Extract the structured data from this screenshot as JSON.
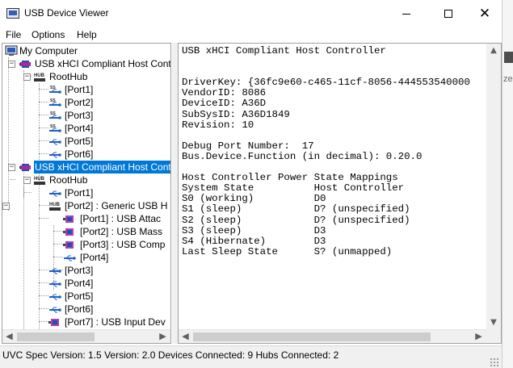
{
  "window": {
    "title": "USB Device Viewer",
    "controls": {
      "minimize": "minimize-icon",
      "maximize": "maximize-icon",
      "close": "close-icon"
    }
  },
  "menu": {
    "items": [
      "File",
      "Options",
      "Help"
    ]
  },
  "tree": {
    "nodes": [
      {
        "label": "My Computer",
        "icon": "computer-icon",
        "expander": ""
      },
      {
        "label": "USB xHCI Compliant Host Contr",
        "icon": "usb-controller-icon",
        "expander": "−"
      },
      {
        "label": "RootHub",
        "icon": "hub-icon",
        "expander": "−"
      },
      {
        "label": "[Port1]",
        "icon": "usb-port-ss-icon"
      },
      {
        "label": "[Port2]",
        "icon": "usb-port-ss-icon"
      },
      {
        "label": "[Port3]",
        "icon": "usb-port-ss-icon"
      },
      {
        "label": "[Port4]",
        "icon": "usb-port-ss-icon"
      },
      {
        "label": "[Port5]",
        "icon": "usb-port-icon"
      },
      {
        "label": "[Port6]",
        "icon": "usb-port-icon"
      },
      {
        "label": "USB xHCI Compliant Host Contr",
        "icon": "usb-controller-icon",
        "expander": "−",
        "selected": true
      },
      {
        "label": "RootHub",
        "icon": "hub-icon",
        "expander": "−"
      },
      {
        "label": "[Port1]",
        "icon": "usb-port-icon"
      },
      {
        "label": "[Port2] :  Generic USB H",
        "icon": "hub-icon",
        "expander": "−"
      },
      {
        "label": "[Port1] :  USB Attac",
        "icon": "usb-device-icon"
      },
      {
        "label": "[Port2] :  USB Mass",
        "icon": "usb-device-icon"
      },
      {
        "label": "[Port3] :  USB Comp",
        "icon": "usb-device-icon"
      },
      {
        "label": "[Port4]",
        "icon": "usb-port-icon"
      },
      {
        "label": "[Port3]",
        "icon": "usb-port-icon"
      },
      {
        "label": "[Port4]",
        "icon": "usb-port-icon"
      },
      {
        "label": "[Port5]",
        "icon": "usb-port-icon"
      },
      {
        "label": "[Port6]",
        "icon": "usb-port-icon"
      },
      {
        "label": "[Port7] :  USB Input Dev",
        "icon": "usb-device-icon"
      }
    ],
    "scroll_left": "scroll-left-icon",
    "scroll_right": "scroll-right-icon"
  },
  "details": {
    "lines": [
      "USB xHCI Compliant Host Controller",
      "",
      "",
      "DriverKey: {36fc9e60-c465-11cf-8056-444553540000",
      "VendorID: 8086",
      "DeviceID: A36D",
      "SubSysID: A36D1849",
      "Revision: 10",
      "",
      "Debug Port Number:  17",
      "Bus.Device.Function (in decimal): 0.20.0",
      "",
      "Host Controller Power State Mappings",
      "System State          Host Controller",
      "S0 (working)          D0",
      "S1 (sleep)            D? (unspecified)",
      "S2 (sleep)            D? (unspecified)",
      "S3 (sleep)            D3",
      "S4 (Hibernate)        D3",
      "Last Sleep State      S? (unmapped)"
    ],
    "scroll_up": "scroll-up-icon",
    "scroll_down": "scroll-down-icon",
    "scroll_left": "scroll-left-icon",
    "scroll_right": "scroll-right-icon"
  },
  "status": {
    "text": "UVC Spec Version: 1.5 Version: 2.0 Devices Connected: 9   Hubs Connected: 2"
  },
  "edge_fragment": "ze",
  "colors": {
    "selection": "#0078d7",
    "window_bg": "#ffffff",
    "chrome": "#f0f0f0"
  }
}
